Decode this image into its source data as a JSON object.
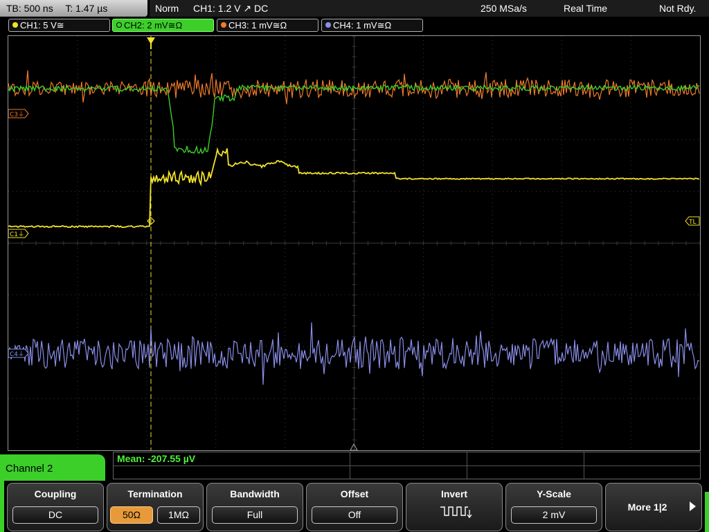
{
  "status": {
    "timebase": "TB: 500 ns",
    "trigger_pos": "T: 1.47 µs",
    "mode": "Norm",
    "trigger": "CH1: 1.2 V ↗ DC",
    "sample_rate": "250 MSa/s",
    "acq_mode": "Real Time",
    "state": "Not Rdy."
  },
  "channels": [
    {
      "label": "CH1: 5 V≅",
      "color": "#f2e22a",
      "active": false
    },
    {
      "label": "CH2: 2 mV≅Ω",
      "color": "#3ccf2a",
      "active": true
    },
    {
      "label": "CH3: 1 mV≅Ω",
      "color": "#f07b2a",
      "active": false
    },
    {
      "label": "CH4: 1 mV≅Ω",
      "color": "#8a8ee8",
      "active": false
    }
  ],
  "markers": {
    "c3": "C3⏚",
    "c1": "C1⏚",
    "c4": "C4⏚",
    "tl": "TL"
  },
  "colors": {
    "ch1": "#f2e22a",
    "ch2": "#3ccf2a",
    "ch3": "#f07b2a",
    "ch4": "#8a8ee8",
    "grid": "#3a3a3a",
    "trigger_line": "#f2e22a"
  },
  "measurement": {
    "text": "Mean: -207.55 µV"
  },
  "menu": {
    "title": "Channel 2",
    "coupling": {
      "label": "Coupling",
      "value": "DC"
    },
    "termination": {
      "label": "Termination",
      "option_a": "50Ω",
      "option_b": "1MΩ",
      "selected": "50Ω"
    },
    "bandwidth": {
      "label": "Bandwidth",
      "value": "Full"
    },
    "offset": {
      "label": "Offset",
      "value": "Off"
    },
    "invert": {
      "label": "Invert",
      "icon": "inverted-square-wave-icon"
    },
    "yscale": {
      "label": "Y-Scale",
      "value": "2 mV"
    },
    "more": {
      "label": "More 1|2",
      "icon": "arrow-right-icon"
    }
  }
}
